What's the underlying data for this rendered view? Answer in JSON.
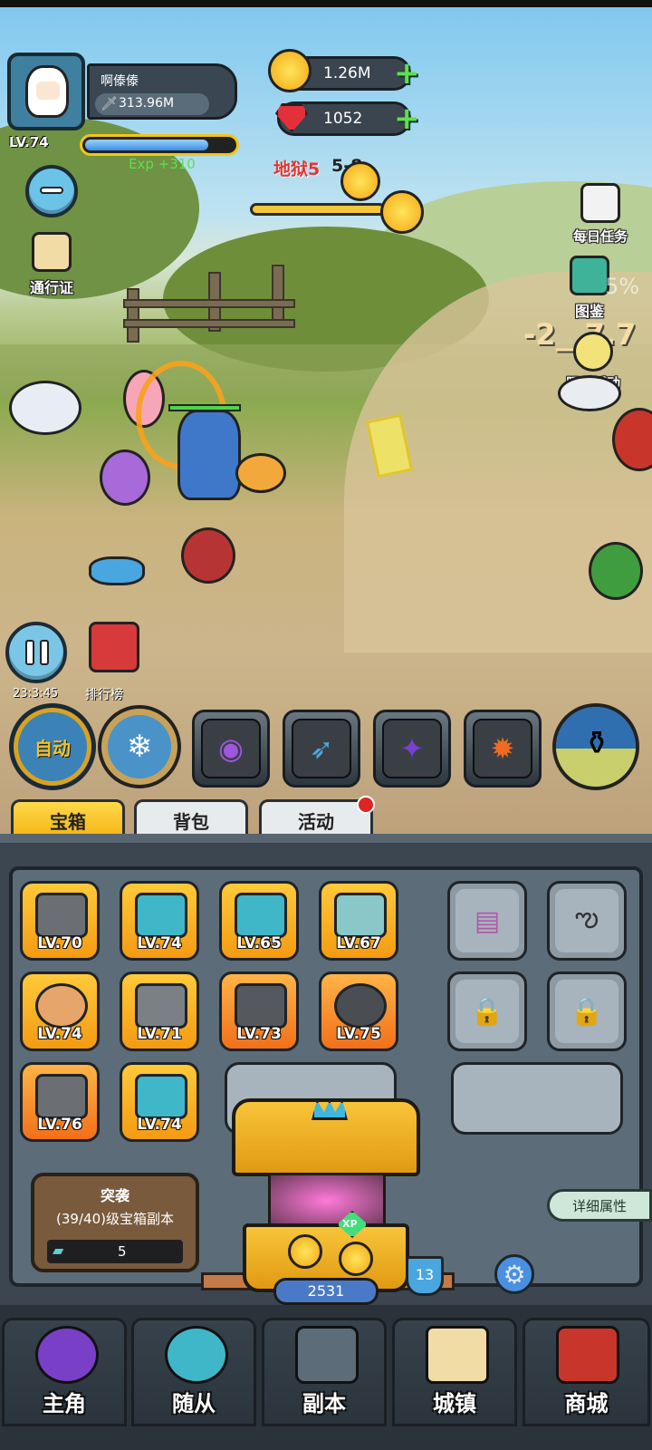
{
  "player": {
    "name": "啊傣傣",
    "power": "313.96M",
    "level": "LV.74",
    "exp_gain": "Exp +310"
  },
  "currency": {
    "gold": "1.26M",
    "gems": "1052"
  },
  "stage": {
    "label_prefix": "地狱5",
    "label_stage": "5-8"
  },
  "left_menu": {
    "pass_label": "通行证",
    "timer": "23:3:45",
    "ranking_label": "排行榜"
  },
  "right_menu": {
    "daily_tasks": "每日任务",
    "codex": "图鉴",
    "limited_event": "限时活动"
  },
  "combat_text": {
    "damage_percent": "5%",
    "damage_number": "-2__7.7"
  },
  "skills": {
    "auto_label": "自动"
  },
  "tabs": {
    "chest": "宝箱",
    "bag": "背包",
    "events": "活动"
  },
  "equipment": [
    {
      "name": "mace",
      "level": "LV.70"
    },
    {
      "name": "helmet",
      "level": "LV.74"
    },
    {
      "name": "armor",
      "level": "LV.65"
    },
    {
      "name": "crossbow",
      "level": "LV.67"
    },
    {
      "name": "ring",
      "level": "LV.74"
    },
    {
      "name": "spear",
      "level": "LV.71"
    },
    {
      "name": "bow",
      "level": "LV.73"
    },
    {
      "name": "shield",
      "level": "LV.75"
    },
    {
      "name": "boots",
      "level": "LV.76"
    },
    {
      "name": "gauntlet",
      "level": "LV.74"
    }
  ],
  "raid": {
    "title": "突袭",
    "subtitle": "(39/40)级宝箱副本",
    "tickets": "5"
  },
  "chest": {
    "count": "2531",
    "badge": "XP",
    "shield_value": "13"
  },
  "details_button": "详细属性",
  "bottom_nav": [
    {
      "key": "hero",
      "label": "主角"
    },
    {
      "key": "followers",
      "label": "随从"
    },
    {
      "key": "dungeon",
      "label": "副本"
    },
    {
      "key": "town",
      "label": "城镇"
    },
    {
      "key": "shop",
      "label": "商城"
    }
  ]
}
